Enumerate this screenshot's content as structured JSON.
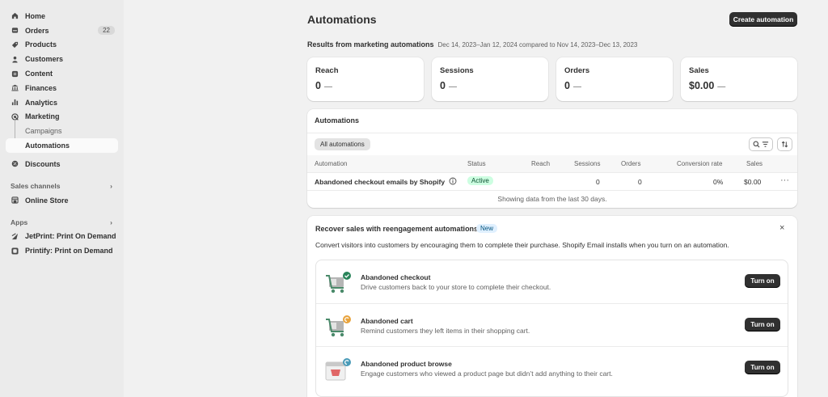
{
  "sidebar": {
    "nav": [
      {
        "label": "Home",
        "icon": "home-icon"
      },
      {
        "label": "Orders",
        "icon": "orders-icon",
        "badge": "22"
      },
      {
        "label": "Products",
        "icon": "tag-icon"
      },
      {
        "label": "Customers",
        "icon": "person-icon"
      },
      {
        "label": "Content",
        "icon": "content-icon"
      },
      {
        "label": "Finances",
        "icon": "bank-icon"
      },
      {
        "label": "Analytics",
        "icon": "bar-chart-icon"
      },
      {
        "label": "Marketing",
        "icon": "target-icon"
      }
    ],
    "marketing_sub": {
      "campaigns": "Campaigns",
      "automations": "Automations"
    },
    "discounts": "Discounts",
    "sales_channels": {
      "heading": "Sales channels",
      "online_store": "Online Store"
    },
    "apps": {
      "heading": "Apps",
      "items": [
        "JetPrint: Print On Demand",
        "Printify: Print on Demand"
      ]
    }
  },
  "header": {
    "title": "Automations",
    "create_button": "Create automation"
  },
  "results": {
    "label": "Results from marketing automations",
    "range": "Dec 14, 2023–Jan 12, 2024 compared to Nov 14, 2023–Dec 13, 2023"
  },
  "metrics": [
    {
      "label": "Reach",
      "value": "0",
      "delta": "—"
    },
    {
      "label": "Sessions",
      "value": "0",
      "delta": "—"
    },
    {
      "label": "Orders",
      "value": "0",
      "delta": "—"
    },
    {
      "label": "Sales",
      "value": "$0.00",
      "delta": "—"
    }
  ],
  "automations_table": {
    "title": "Automations",
    "filter_tab": "All automations",
    "columns": [
      "Automation",
      "Status",
      "Reach",
      "Sessions",
      "Orders",
      "Conversion rate",
      "Sales"
    ],
    "rows": [
      {
        "name": "Abandoned checkout emails by Shopify",
        "status": "Active",
        "reach": "",
        "sessions": "0",
        "orders": "0",
        "conversion": "0%",
        "sales": "$0.00"
      }
    ],
    "footer": "Showing data from the last 30 days."
  },
  "recover": {
    "title": "Recover sales with reengagement automations",
    "badge": "New",
    "close": "×",
    "description": "Convert visitors into customers by encouraging them to complete their purchase. Shopify Email installs when you turn on an automation.",
    "items": [
      {
        "title": "Abandoned checkout",
        "desc": "Drive customers back to your store to complete their checkout.",
        "button": "Turn on",
        "illustration": "cart-check-illustration"
      },
      {
        "title": "Abandoned cart",
        "desc": "Remind customers they left items in their shopping cart.",
        "button": "Turn on",
        "illustration": "cart-refresh-illustration"
      },
      {
        "title": "Abandoned product browse",
        "desc": "Engage customers who viewed a product page but didn’t add anything to their cart.",
        "button": "Turn on",
        "illustration": "browser-refresh-illustration"
      }
    ]
  },
  "colors": {
    "primary_button": "#303030",
    "active_badge_bg": "#cdfee1",
    "new_badge_bg": "#e0f0ff",
    "sidebar_bg": "#ebebeb",
    "page_bg": "#f1f1f1"
  }
}
